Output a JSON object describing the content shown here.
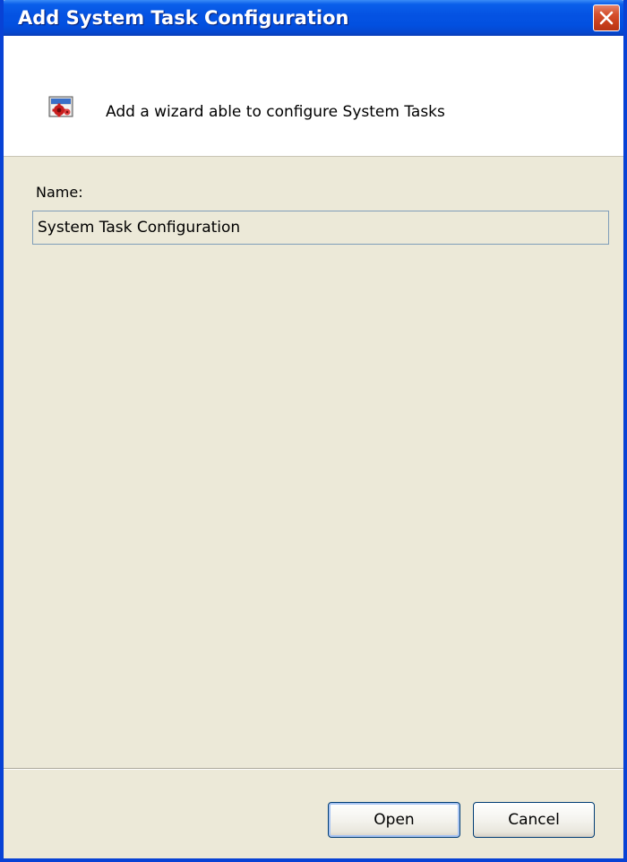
{
  "window": {
    "title": "Add System Task Configuration"
  },
  "header": {
    "description": "Add a wizard able to configure System Tasks",
    "icon": "system-task-wizard-icon"
  },
  "form": {
    "name_label": "Name:",
    "name_value": "System Task Configuration"
  },
  "buttons": {
    "open_label": "Open",
    "cancel_label": "Cancel"
  },
  "colors": {
    "titlebar": "#0553E3",
    "dialog_bg": "#ECE9D8",
    "close_button": "#D5502E"
  }
}
